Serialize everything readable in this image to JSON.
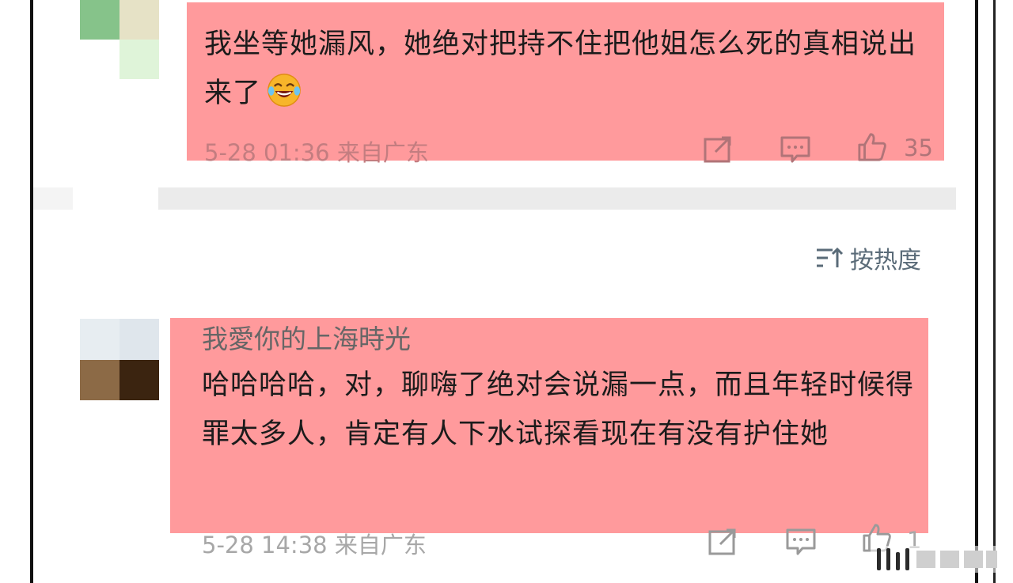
{
  "comments": [
    {
      "username": "",
      "text": "我坐等她漏风，她绝对把持不住把他姐怎么死的真相说出来了",
      "emoji": "laughing-tears-emoji",
      "date": "5-28 01:36",
      "location": "来自广东",
      "likes": "35"
    },
    {
      "username": "我愛你的上海時光",
      "text": "哈哈哈哈，对，聊嗨了绝对会说漏一点，而且年轻时候得罪太多人，肯定有人下水试探看现在有没有护住她",
      "date": "5-28 14:38",
      "location": "来自广东",
      "likes": "1"
    }
  ],
  "sort": {
    "label": "按热度",
    "icon": "sort-icon"
  },
  "colors": {
    "highlight": "#ff9a9c",
    "meta": "#a7a7a7",
    "sort": "#5a6b78",
    "divider": "#ebebeb"
  },
  "icons": [
    "share-icon",
    "comment-icon",
    "like-icon",
    "laughing-tears-emoji"
  ]
}
